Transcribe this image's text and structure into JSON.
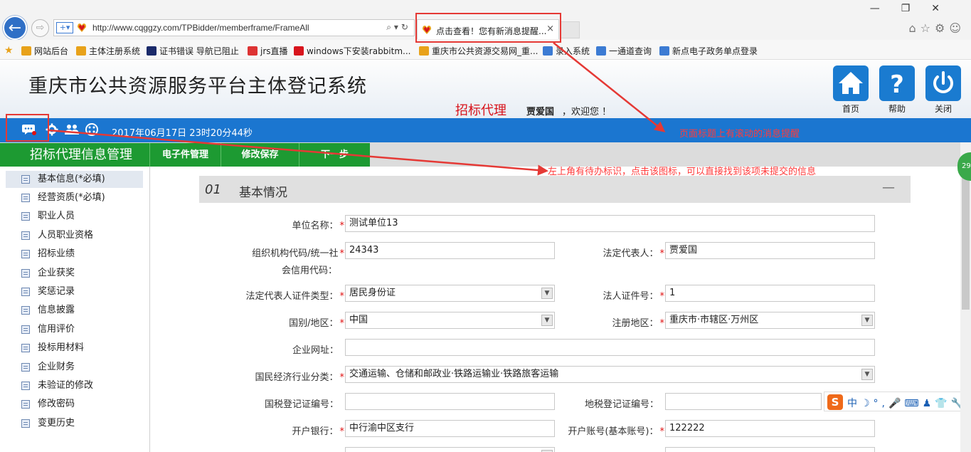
{
  "browser": {
    "url": "http://www.cqggzy.com/TPBidder/memberframe/FrameAll",
    "tab_title": "点击查看！您有新消息提醒...",
    "tab_close": "×",
    "back": "←",
    "forward": "⇨",
    "compat": "+▾",
    "addr_tools": "⌕▾↻",
    "win_controls": "—❐✕",
    "right_tools": "⌂☆⚙☺",
    "favorites": [
      "网站后台",
      "主体注册系统",
      "证书错误 导航已阻止",
      "jrs直播",
      "windows下安装rabbitm...",
      "重庆市公共资源交易网_重...",
      "录入系统",
      "一通道查询",
      "新点电子政务单点登录"
    ]
  },
  "header": {
    "title": "重庆市公共资源服务平台主体登记系统",
    "role": "招标代理",
    "user": "贾爱国",
    "greeting": "，欢迎您 ！",
    "buttons": [
      {
        "label": "首页",
        "icon": "home-icon"
      },
      {
        "label": "帮助",
        "icon": "help-icon"
      },
      {
        "label": "关闭",
        "icon": "power-icon"
      }
    ]
  },
  "bluebar": {
    "time": "2017年06月17日 23时20分44秒"
  },
  "annotations": {
    "scroll_msg": "页面标题上有滚动的消息提醒",
    "todo_msg": "左上角有待办标识，点击该图标，可以直接找到该项未提交的信息"
  },
  "toolbar": {
    "section": "招标代理信息管理",
    "buttons": [
      "电子件管理",
      "修改保存",
      "下一步"
    ]
  },
  "sidebar": {
    "items": [
      "基本信息(*必填)",
      "经营资质(*必填)",
      "职业人员",
      "人员职业资格",
      "招标业绩",
      "企业获奖",
      "奖惩记录",
      "信息披露",
      "信用评价",
      "投标用材料",
      "企业财务",
      "未验证的修改",
      "修改密码",
      "变更历史"
    ]
  },
  "panel": {
    "num": "01",
    "title": "基本情况",
    "collapse": "—"
  },
  "form": {
    "unit_name": {
      "label": "单位名称：",
      "value": "测试单位13"
    },
    "org_code": {
      "label1": "组织机构代码/统一社",
      "label2": "会信用代码：",
      "value": "24343"
    },
    "legal_rep": {
      "label": "法定代表人：",
      "value": "贾爱国"
    },
    "id_type": {
      "label": "法定代表人证件类型：",
      "value": "居民身份证"
    },
    "id_no": {
      "label": "法人证件号：",
      "value": "1"
    },
    "country": {
      "label": "国别/地区：",
      "value": "中国"
    },
    "reg_area": {
      "label": "注册地区：",
      "value": "重庆市·市辖区·万州区"
    },
    "website": {
      "label": "企业网址：",
      "value": ""
    },
    "industry": {
      "label": "国民经济行业分类：",
      "value": "交通运输、仓储和邮政业·铁路运输业·铁路旅客运输"
    },
    "national_tax": {
      "label": "国税登记证编号：",
      "value": ""
    },
    "local_tax": {
      "label": "地税登记证编号：",
      "value": ""
    },
    "bank": {
      "label": "开户银行：",
      "value": "中行渝中区支行"
    },
    "account": {
      "label": "开户账号(基本账号)：",
      "value": "122222"
    }
  },
  "ime": {
    "logo": "S",
    "tools": "中☽°,🎤⌨♟👕🔧"
  },
  "badge": "29",
  "colors": {
    "blue": "#1b76d0",
    "green": "#1d9a32",
    "red": "#e53935"
  }
}
